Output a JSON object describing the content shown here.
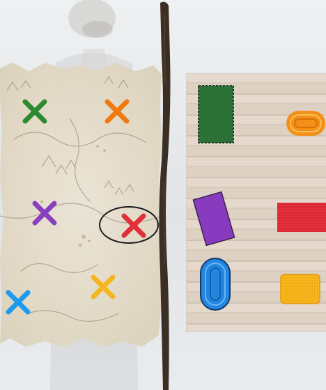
{
  "scene": {
    "description_colors": {
      "background": "#e6e8ea",
      "parchment": "#e3dac6",
      "stick": "#3a2f22",
      "panel": "#ddd1c3",
      "circle": "#1a1a1a"
    }
  },
  "map": {
    "markers": [
      {
        "id": "green",
        "color": "#2e8a2e"
      },
      {
        "id": "orange",
        "color": "#f07a12"
      },
      {
        "id": "purple",
        "color": "#8a3fc0"
      },
      {
        "id": "red",
        "color": "#e0303a",
        "circled": true
      },
      {
        "id": "yellow",
        "color": "#f5b51e"
      },
      {
        "id": "blue",
        "color": "#1e9af0"
      }
    ]
  },
  "pieces": [
    {
      "id": "green-rectangle",
      "shape": "rectangle",
      "color": "#2f7a3a"
    },
    {
      "id": "orange-oval",
      "shape": "oval",
      "color": "#f39018"
    },
    {
      "id": "purple-rectangle",
      "shape": "tilted-rectangle",
      "color": "#8e3fc6"
    },
    {
      "id": "red-rectangle",
      "shape": "rectangle",
      "color": "#e6303c"
    },
    {
      "id": "blue-oval",
      "shape": "vertical-oval",
      "color": "#2286e0"
    },
    {
      "id": "yellow-square",
      "shape": "rounded-rectangle",
      "color": "#f8b51c"
    }
  ]
}
